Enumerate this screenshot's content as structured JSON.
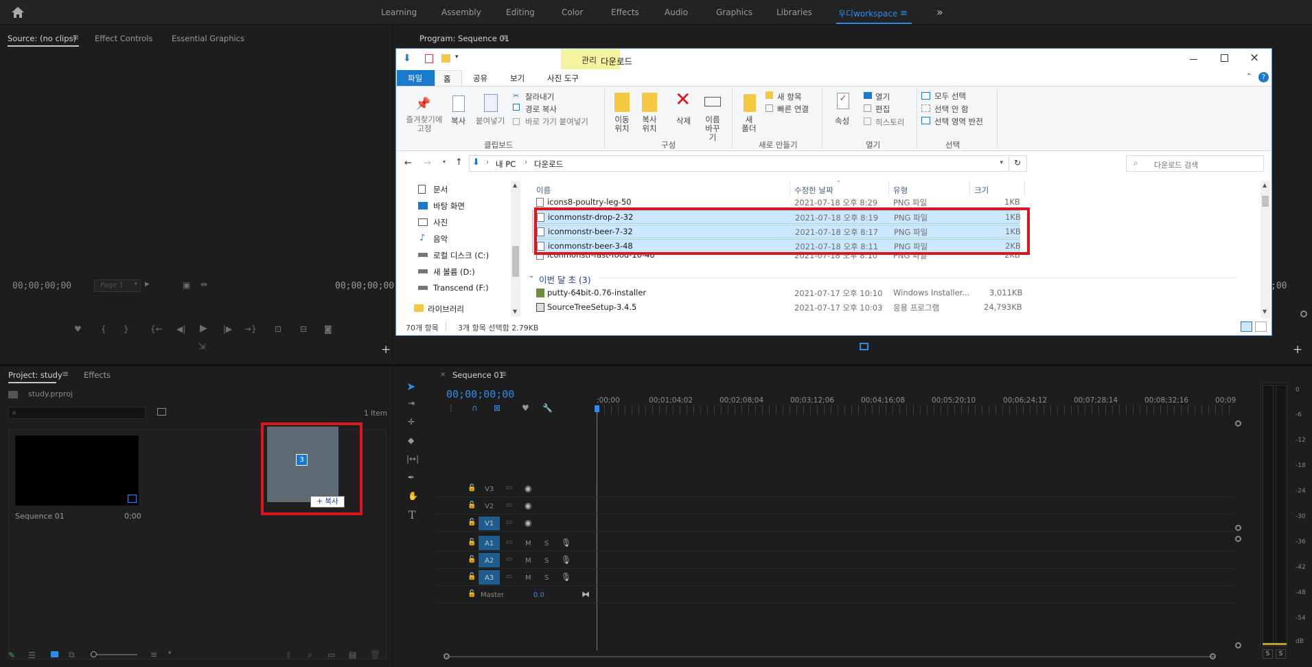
{
  "workspaces": [
    "Learning",
    "Assembly",
    "Editing",
    "Color",
    "Effects",
    "Audio",
    "Graphics",
    "Libraries"
  ],
  "active_workspace": "우디workspace",
  "source_panel": {
    "tabs": [
      "Source: (no clips)",
      "Effect Controls",
      "Essential Graphics"
    ],
    "timecode_left": "00;00;00;00",
    "timecode_right": "00;00;00;00",
    "page_select": "Page 1"
  },
  "program_panel": {
    "title": "Program: Sequence 01",
    "timecode_right": ";00"
  },
  "project_panel": {
    "tabs": [
      "Project: study",
      "Effects"
    ],
    "file": "study.prproj",
    "item_count": "1 Item",
    "sequence_name": "Sequence 01",
    "sequence_duration": "0;00",
    "drag_count": "3",
    "drag_copy_label": "+ 복사"
  },
  "timeline": {
    "tab": "Sequence 01",
    "timecode": "00;00;00;00",
    "ruler": [
      ";00;00",
      "00;01;04;02",
      "00;02;08;04",
      "00;03;12;06",
      "00;04;16;08",
      "00;05;20;10",
      "00;06;24;12",
      "00;07;28;14",
      "00;08;32;16",
      "00;09"
    ],
    "video_tracks": [
      "V3",
      "V2",
      "V1"
    ],
    "audio_tracks": [
      "A1",
      "A2",
      "A3"
    ],
    "audio_mute": "M",
    "audio_solo": "S",
    "master_label": "Master",
    "master_value": "0.0"
  },
  "meter": {
    "scale": [
      "0",
      "-6",
      "-12",
      "-18",
      "-24",
      "-30",
      "-36",
      "-42",
      "-48",
      "-54",
      "dB"
    ],
    "solo_buttons": [
      "S",
      "S"
    ]
  },
  "explorer": {
    "title": "다운로드",
    "context_tab_header": "관리",
    "ribbon_tabs": [
      "파일",
      "홈",
      "공유",
      "보기",
      "사진 도구"
    ],
    "clipboard": {
      "pin": "즐겨찾기에 고정",
      "copy": "복사",
      "paste": "붙여넣기",
      "cut": "잘라내기",
      "copy_path": "경로 복사",
      "paste_shortcut": "바로 가기 붙여넣기",
      "group": "클립보드"
    },
    "organize": {
      "move_to": "이동 위치",
      "copy_to": "복사 위치",
      "delete": "삭제",
      "rename": "이름 바꾸기",
      "group": "구성"
    },
    "new": {
      "new_folder": "새 폴더",
      "new_item": "새 항목",
      "easy_access": "빠른 연결",
      "group": "새로 만들기"
    },
    "open": {
      "properties": "속성",
      "open": "열기",
      "edit": "편집",
      "history": "히스토리",
      "group": "열기"
    },
    "select": {
      "select_all": "모두 선택",
      "select_none": "선택 안 함",
      "invert": "선택 영역 반전",
      "group": "선택"
    },
    "breadcrumb": [
      "내 PC",
      "다운로드"
    ],
    "search_placeholder": "다운로드 검색",
    "nav": [
      "문서",
      "바탕 화면",
      "사진",
      "음악",
      "로컬 디스크 (C:)",
      "새 볼륨 (D:)",
      "Transcend (F:)",
      "라이브러리"
    ],
    "columns": [
      "이름",
      "수정한 날짜",
      "유형",
      "크기"
    ],
    "files": [
      {
        "name": "icons8-poultry-leg-50",
        "date": "2021-07-18 오후 8:29",
        "type": "PNG 파일",
        "size": "1KB"
      },
      {
        "name": "iconmonstr-drop-2-32",
        "date": "2021-07-18 오후 8:19",
        "type": "PNG 파일",
        "size": "1KB"
      },
      {
        "name": "iconmonstr-beer-7-32",
        "date": "2021-07-18 오후 8:17",
        "type": "PNG 파일",
        "size": "1KB"
      },
      {
        "name": "iconmonstr-beer-3-48",
        "date": "2021-07-18 오후 8:11",
        "type": "PNG 파일",
        "size": "2KB"
      },
      {
        "name": "iconmonstr-fast-food-10-48",
        "date": "2021-07-18 오후 8:10",
        "type": "PNG 파일",
        "size": "2KB"
      }
    ],
    "group_header": "이번 달 초 (3)",
    "files2": [
      {
        "name": "putty-64bit-0.76-installer",
        "date": "2021-07-17 오후 10:10",
        "type": "Windows Installer...",
        "size": "3,011KB"
      },
      {
        "name": "SourceTreeSetup-3.4.5",
        "date": "2021-07-17 오후 10:03",
        "type": "응용 프로그램",
        "size": "24,793KB"
      }
    ],
    "status_count": "70개 항목",
    "status_selected": "3개 항목 선택함 2.79KB"
  },
  "colors": {
    "accent_blue": "#2d8ceb",
    "highlight_red": "#e0141c",
    "selection_fill": "#cce8ff",
    "ribbon_file_tab": "#1979ca",
    "context_tab": "#f3f3a0"
  }
}
